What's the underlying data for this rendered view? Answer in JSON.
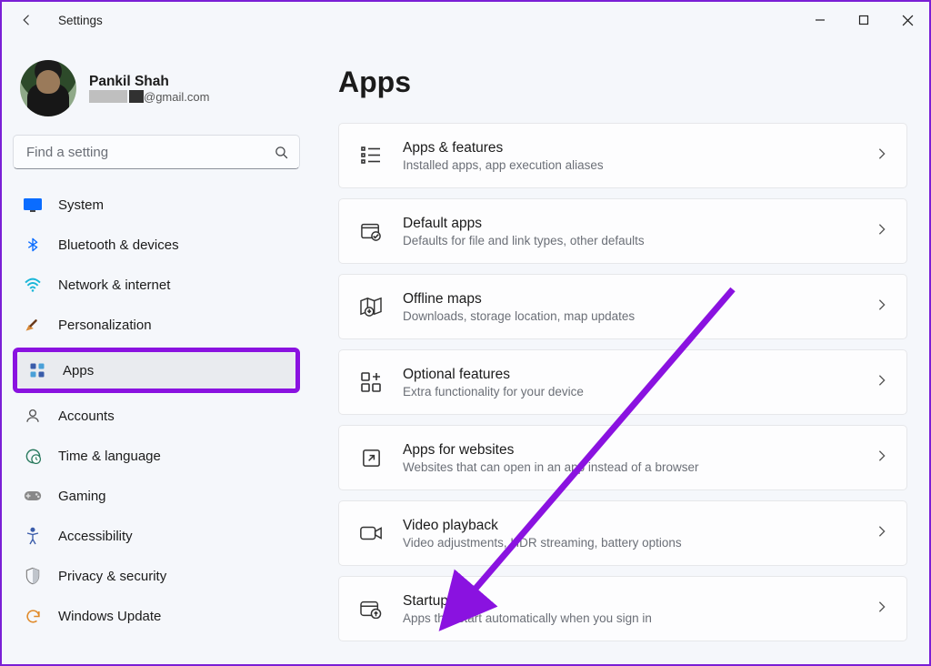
{
  "app": {
    "title": "Settings"
  },
  "user": {
    "name": "Pankil Shah",
    "email_suffix": "@gmail.com"
  },
  "search": {
    "placeholder": "Find a setting"
  },
  "sidebar": {
    "items": [
      {
        "id": "system",
        "label": "System"
      },
      {
        "id": "bluetooth",
        "label": "Bluetooth & devices"
      },
      {
        "id": "network",
        "label": "Network & internet"
      },
      {
        "id": "personalization",
        "label": "Personalization"
      },
      {
        "id": "apps",
        "label": "Apps",
        "active": true
      },
      {
        "id": "accounts",
        "label": "Accounts"
      },
      {
        "id": "time",
        "label": "Time & language"
      },
      {
        "id": "gaming",
        "label": "Gaming"
      },
      {
        "id": "accessibility",
        "label": "Accessibility"
      },
      {
        "id": "privacy",
        "label": "Privacy & security"
      },
      {
        "id": "update",
        "label": "Windows Update"
      }
    ]
  },
  "page": {
    "title": "Apps",
    "cards": [
      {
        "id": "apps-features",
        "title": "Apps & features",
        "sub": "Installed apps, app execution aliases"
      },
      {
        "id": "default-apps",
        "title": "Default apps",
        "sub": "Defaults for file and link types, other defaults"
      },
      {
        "id": "offline-maps",
        "title": "Offline maps",
        "sub": "Downloads, storage location, map updates"
      },
      {
        "id": "optional-features",
        "title": "Optional features",
        "sub": "Extra functionality for your device"
      },
      {
        "id": "apps-websites",
        "title": "Apps for websites",
        "sub": "Websites that can open in an app instead of a browser"
      },
      {
        "id": "video-playback",
        "title": "Video playback",
        "sub": "Video adjustments, HDR streaming, battery options"
      },
      {
        "id": "startup",
        "title": "Startup",
        "sub": "Apps that start automatically when you sign in"
      }
    ]
  },
  "annotation": {
    "type": "arrow",
    "color": "#8a12e0",
    "points_to": "startup"
  }
}
